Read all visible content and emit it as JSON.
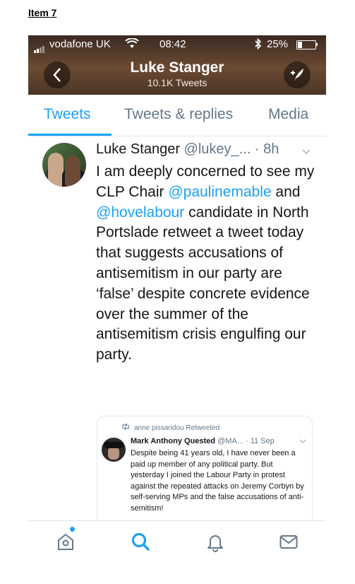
{
  "item_label": "Item 7",
  "status_bar": {
    "carrier": "vodafone UK",
    "time": "08:42",
    "battery_pct": "25%",
    "battery_level": 0.25
  },
  "header": {
    "back_icon": "chevron-left-icon",
    "name": "Luke Stanger",
    "tweet_count": "10.1K Tweets",
    "compose_icon": "compose-tweet-icon"
  },
  "tabs": [
    {
      "label": "Tweets",
      "active": true
    },
    {
      "label": "Tweets & replies",
      "active": false
    },
    {
      "label": "Media",
      "active": false
    }
  ],
  "tweet": {
    "name": "Luke Stanger",
    "handle": "@lukey_...",
    "time": "· 8h",
    "body": {
      "part1": "I am deeply concerned to see my CLP Chair ",
      "mention1": "@paulinemable",
      "part2": " and ",
      "mention2": "@hovelabour",
      "part3": " candidate in North Portslade retweet a tweet today that suggests accusations of antisemitism in our party are ‘false’ despite concrete evidence over the summer of the antisemitism crisis engulfing our party."
    }
  },
  "quoted_tweet": {
    "retweeted_by": "anne pissaridou Retweeted",
    "name": "Mark Anthony Quested",
    "handle": "@MA...",
    "date": "· 11 Sep",
    "body": "Despite being 41 years old, I have never been a paid up member of any political party.  But yesterday I joined the Labour Party in protest against the repeated attacks on Jeremy Corbyn by self-serving MPs and the false accusations of anti-semitism!"
  },
  "bottom_nav": [
    {
      "icon": "home-icon",
      "active": false,
      "has_notification_dot": true
    },
    {
      "icon": "search-icon",
      "active": true
    },
    {
      "icon": "bell-icon",
      "active": false
    },
    {
      "icon": "mail-icon",
      "active": false
    }
  ],
  "colors": {
    "accent": "#1da1f2",
    "text": "#14171a",
    "secondary_text": "#657786",
    "divider": "#e1e8ed"
  }
}
